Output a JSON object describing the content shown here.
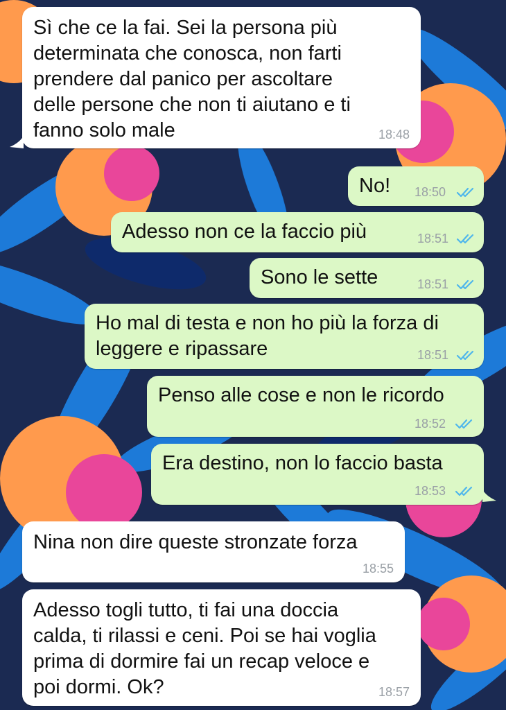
{
  "messages": [
    {
      "direction": "in",
      "text": "Sì che ce la fai. Sei la persona più\ndeterminata che conosca, non farti\nprendere dal panico per ascoltare\ndelle persone che non ti aiutano e ti\nfanno solo male",
      "time": "18:48"
    },
    {
      "direction": "out",
      "text": "No!",
      "time": "18:50",
      "status": "read"
    },
    {
      "direction": "out",
      "text": "Adesso non ce la faccio più",
      "time": "18:51",
      "status": "read"
    },
    {
      "direction": "out",
      "text": "Sono le sette",
      "time": "18:51",
      "status": "read"
    },
    {
      "direction": "out",
      "text": "Ho mal di testa e non ho più la forza di\nleggere e ripassare",
      "time": "18:51",
      "status": "read"
    },
    {
      "direction": "out",
      "text": "Penso alle cose e non le ricordo",
      "time": "18:52",
      "status": "read"
    },
    {
      "direction": "out",
      "text": "Era destino, non lo faccio basta",
      "time": "18:53",
      "status": "read"
    },
    {
      "direction": "in",
      "text": "Nina non dire queste stronzate forza",
      "time": "18:55"
    },
    {
      "direction": "in",
      "text": "Adesso togli tutto, ti fai una doccia\ncalda, ti rilassi e ceni. Poi se hai voglia\nprima di dormire fai un recap veloce e\npoi dormi. Ok?",
      "time": "18:57"
    }
  ],
  "colors": {
    "incoming_bubble": "#ffffff",
    "outgoing_bubble": "#dcf8c6",
    "read_ticks": "#4fb6ec",
    "timestamp": "#9aa0a6",
    "wallpaper_base": "#1b2a52",
    "wallpaper_leaf": "#1e7fe0",
    "wallpaper_flower_orange": "#ff9a4d",
    "wallpaper_flower_pink": "#e9469a"
  },
  "icons": {
    "read_status": "double-check-icon"
  }
}
